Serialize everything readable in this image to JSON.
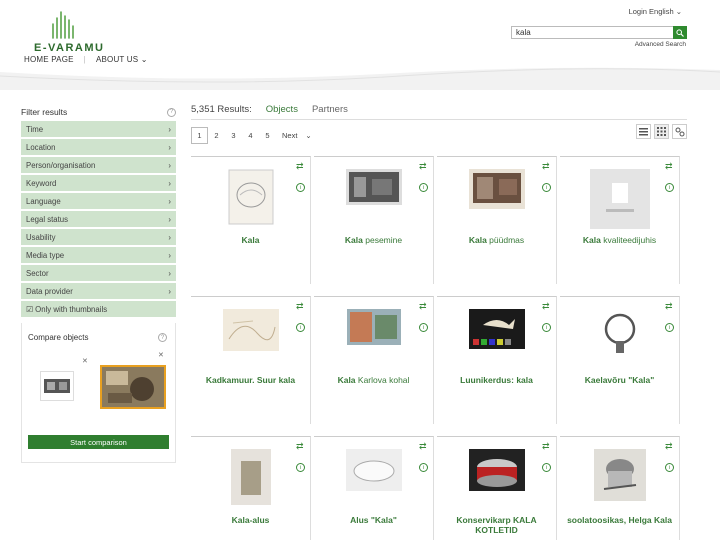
{
  "header": {
    "logo_text": "E-VARAMU",
    "login": "Login English ⌄",
    "search_value": "kala",
    "advanced_search": "Advanced Search",
    "nav": [
      "HOME PAGE",
      "ABOUT US ⌄"
    ]
  },
  "sidebar": {
    "title": "Filter results",
    "filters": [
      "Time",
      "Location",
      "Person/organisation",
      "Keyword",
      "Language",
      "Legal status",
      "Usability",
      "Media type",
      "Sector",
      "Data provider"
    ],
    "thumbnails_option": "☑ Only with thumbnails",
    "compare_title": "Compare objects",
    "start_button": "Start comparison"
  },
  "results": {
    "count": "5,351 Results:",
    "tab_objects": "Objects",
    "tab_partners": "Partners",
    "pages": [
      "1",
      "2",
      "3",
      "4",
      "5"
    ],
    "next": "Next",
    "items": [
      {
        "kw": "Kala",
        "rest": ""
      },
      {
        "kw": "Kala",
        "rest": " peseminе"
      },
      {
        "kw": "Kala",
        "rest": " püüdmas"
      },
      {
        "kw": "Kala",
        "rest": " kvaliteedijuhis"
      },
      {
        "kw": "Kadkamuur. Suur kala",
        "rest": ""
      },
      {
        "kw": "Kala",
        "rest": " Karlova kohal"
      },
      {
        "kw": "Luunikerdus: kala",
        "rest": ""
      },
      {
        "kw": "Kaelavõru \"Kala\"",
        "rest": ""
      },
      {
        "kw": "Kala-alus",
        "rest": ""
      },
      {
        "kw": "Alus \"Kala\"",
        "rest": ""
      },
      {
        "kw": "Konservikarp KALA KOTLETID",
        "rest": ""
      },
      {
        "kw": "soolatoosikas, Helga Kala",
        "rest": ""
      }
    ]
  },
  "colors": {
    "accent": "#2f7e2f",
    "filter_bg": "#cfe3cd"
  }
}
